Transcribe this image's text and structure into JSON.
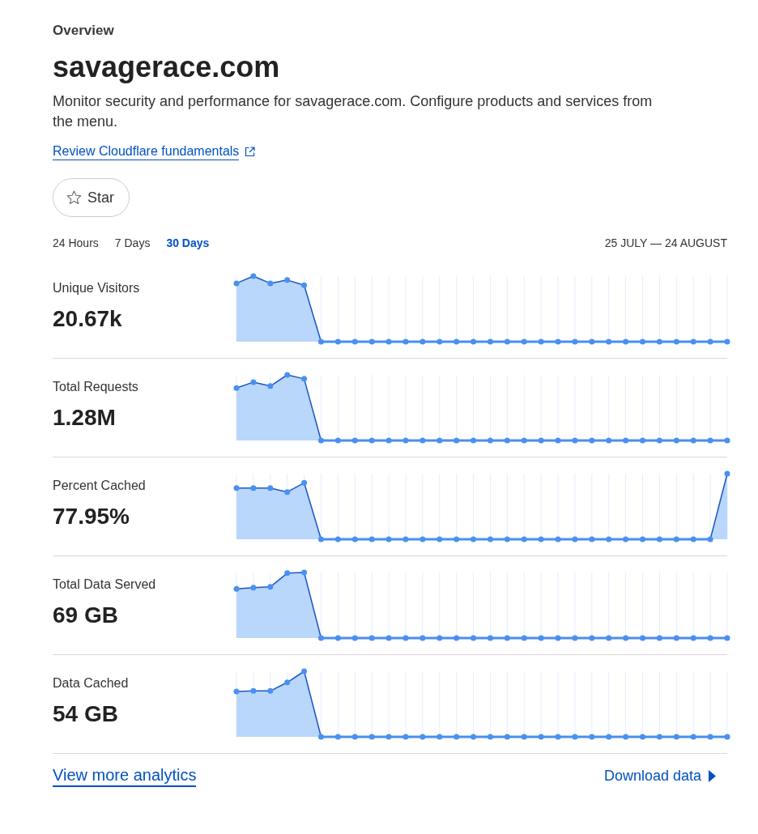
{
  "header": {
    "eyebrow": "Overview",
    "title": "savagerace.com",
    "description": "Monitor security and performance for savagerace.com. Configure products and services from the menu.",
    "link": "Review Cloudflare fundamentals"
  },
  "star_button": {
    "label": "Star",
    "starred": false
  },
  "time_ranges": [
    {
      "label": "24 Hours",
      "selected": false
    },
    {
      "label": "7 Days",
      "selected": false
    },
    {
      "label": "30 Days",
      "selected": true
    }
  ],
  "date_range": "25 JULY — 24 AUGUST",
  "metrics": [
    {
      "label": "Unique Visitors",
      "value": "20.67k"
    },
    {
      "label": "Total Requests",
      "value": "1.28M"
    },
    {
      "label": "Percent Cached",
      "value": "77.95%"
    },
    {
      "label": "Total Data Served",
      "value": "69 GB"
    },
    {
      "label": "Data Cached",
      "value": "54 GB"
    }
  ],
  "footer": {
    "analytics_link": "View more analytics",
    "download_link": "Download data"
  }
}
